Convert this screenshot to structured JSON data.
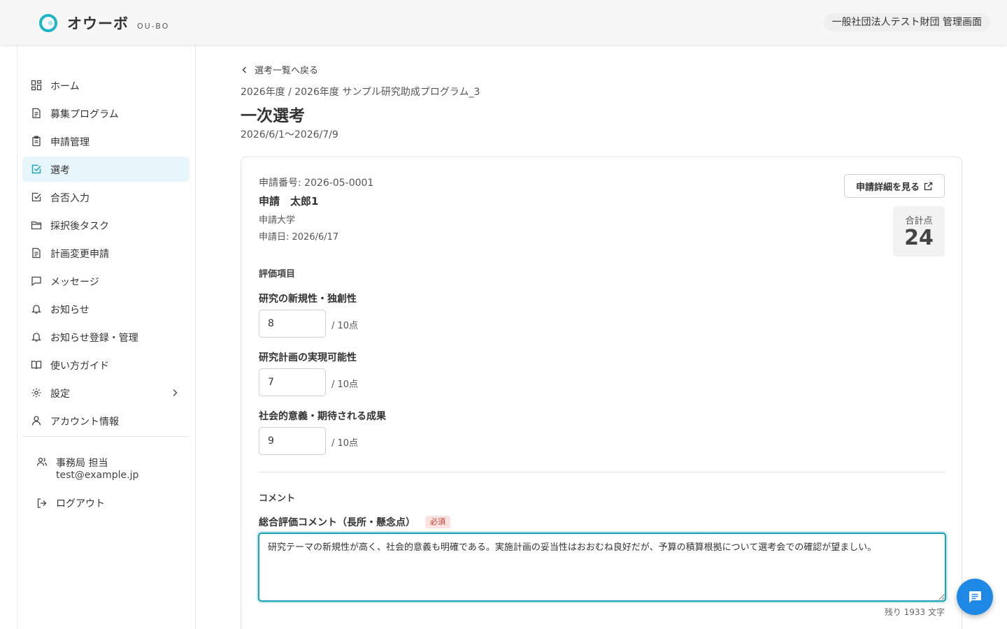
{
  "header": {
    "logo_text": "オウーボ",
    "logo_sub": "OU-BO",
    "org_name": "一般社団法人テスト財団 管理画面"
  },
  "sidebar": {
    "items": [
      {
        "label": "ホーム",
        "icon": "grid-icon"
      },
      {
        "label": "募集プログラム",
        "icon": "document-icon"
      },
      {
        "label": "申請管理",
        "icon": "clipboard-icon"
      },
      {
        "label": "選考",
        "icon": "check-square-icon",
        "active": true
      },
      {
        "label": "合否入力",
        "icon": "check-square-icon"
      },
      {
        "label": "採択後タスク",
        "icon": "folder-icon"
      },
      {
        "label": "計画変更申請",
        "icon": "document-icon"
      },
      {
        "label": "メッセージ",
        "icon": "chat-icon"
      },
      {
        "label": "お知らせ",
        "icon": "bell-icon"
      },
      {
        "label": "お知らせ登録・管理",
        "icon": "bell-icon"
      },
      {
        "label": "使い方ガイド",
        "icon": "book-icon"
      },
      {
        "label": "設定",
        "icon": "gear-icon",
        "has_chevron": true
      },
      {
        "label": "アカウント情報",
        "icon": "user-icon"
      }
    ],
    "user": {
      "name": "事務局 担当",
      "email": "test@example.jp"
    },
    "logout_label": "ログアウト"
  },
  "main": {
    "back_label": "選考一覧へ戻る",
    "breadcrumb": "2026年度 / 2026年度 サンプル研究助成プログラム_3",
    "title": "一次選考",
    "period": "2026/6/1〜2026/7/9"
  },
  "application": {
    "number": "申請番号: 2026-05-0001",
    "applicant_name": "申請　太郎1",
    "university": "申請大学",
    "date": "申請日: 2026/6/17",
    "detail_button": "申請詳細を見る",
    "total_label": "合計点",
    "total_value": "24"
  },
  "evaluation": {
    "section_title": "評価項目",
    "criteria": [
      {
        "label": "研究の新規性・独創性",
        "value": "8",
        "max": "/ 10点"
      },
      {
        "label": "研究計画の実現可能性",
        "value": "7",
        "max": "/ 10点"
      },
      {
        "label": "社会的意義・期待される成果",
        "value": "9",
        "max": "/ 10点"
      }
    ]
  },
  "comment": {
    "section_title": "コメント",
    "label": "総合評価コメント（長所・懸念点）",
    "required_badge": "必須",
    "value": "研究テーマの新規性が高く、社会的意義も明確である。実施計画の妥当性はおおむね良好だが、予算の積算根拠について選考会での確認が望ましい。",
    "remaining": "残り 1933 文字"
  },
  "colors": {
    "accent": "#17a2b8",
    "active_bg": "#e6f6fa",
    "fab": "#1e88e5",
    "required_bg": "#fde2e2",
    "required_text": "#c0392b"
  }
}
